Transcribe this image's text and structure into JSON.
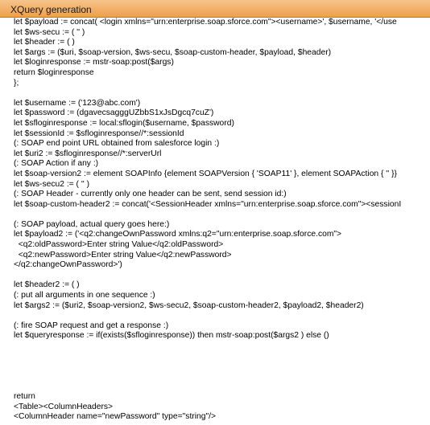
{
  "window": {
    "title": "XQuery generation"
  },
  "editor": {
    "lines": [
      "let $payload := concat( <login xmlns=\"urn:enterprise.soap.sforce.com\"><username>', $username, '</use",
      "let $ws-secu := ( '' )",
      "let $header := ( )",
      "let $args := ($uri, $soap-version, $ws-secu, $soap-custom-header, $payload, $header)",
      "let $loginresponse := mstr-soap:post($args)",
      "return $loginresponse",
      "};",
      "",
      "let $username := ('123@abc.com')",
      "let $password := (dgavecsagggUZbbS1xJsDgcq7cuZ')",
      "let $sfloginresponse := local:sflogin($username, $password)",
      "let $sessionId := $sfloginresponse//*:sessionId",
      "(: SOAP end point URL obtained from salesforce login :)",
      "let $uri2 := $sfloginresponse//*:serverUrl",
      "(: SOAP Action if any :)",
      "let $soap-version2 := element SOAPInfo {element SOAPVersion { 'SOAP11' }, element SOAPAction { '' }}",
      "let $ws-secu2 := ( '' )",
      "(: SOAP Header - currently only one header can be sent, send session id:)",
      "let $soap-custom-header2 := concat('<SessionHeader xmlns=\"urn:enterprise.soap.sforce.com\"><sessionI",
      "",
      "(: SOAP payload, actual query goes here:)",
      "let $payload2 := ('<q2:changeOwnPassword xmlns:q2=\"urn:enterprise.soap.sforce.com\">",
      "  <q2:oldPassword>Enter string Value</q2:oldPassword>",
      "  <q2:newPassword>Enter string Value</q2:newPassword>",
      "</q2:changeOwnPassword>')",
      "",
      "let $header2 := ( )",
      "(: put all arguments in one sequence :)",
      "let $args2 := ($uri2, $soap-version2, $ws-secu2, $soap-custom-header2, $payload2, $header2)",
      "",
      "(: fire SOAP request and get a response :)",
      "let $queryresponse := if(exists($sfloginresponse)) then mstr-soap:post($args2 ) else ()",
      "",
      "",
      "",
      "",
      "",
      "return",
      "<Table><ColumnHeaders>",
      "<ColumnHeader name=\"newPassword\" type=\"string\"/>"
    ]
  }
}
